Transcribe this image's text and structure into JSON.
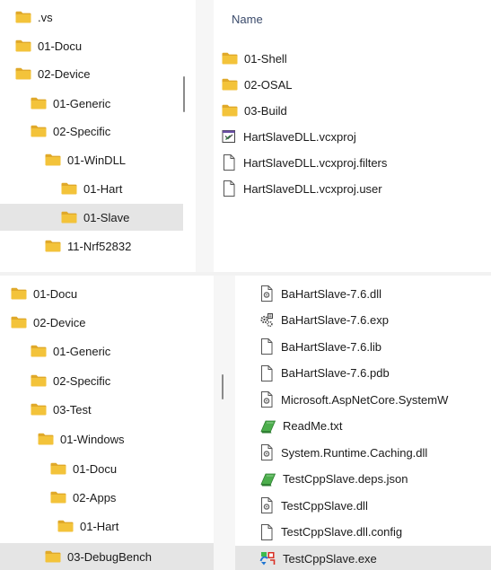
{
  "top_panel": {
    "column_header": "Name",
    "tree": [
      {
        "label": ".vs",
        "icon": "folder-icon",
        "selected": false
      },
      {
        "label": "01-Docu",
        "icon": "folder-icon",
        "selected": false
      },
      {
        "label": "02-Device",
        "icon": "folder-icon",
        "selected": false
      },
      {
        "label": "01-Generic",
        "icon": "folder-icon",
        "selected": false
      },
      {
        "label": "02-Specific",
        "icon": "folder-icon",
        "selected": false
      },
      {
        "label": "01-WinDLL",
        "icon": "folder-icon",
        "selected": false
      },
      {
        "label": "01-Hart",
        "icon": "folder-icon",
        "selected": false
      },
      {
        "label": "01-Slave",
        "icon": "folder-icon",
        "selected": true
      },
      {
        "label": "11-Nrf52832",
        "icon": "folder-icon",
        "selected": false
      }
    ],
    "files": [
      {
        "label": "01-Shell",
        "icon": "folder-icon"
      },
      {
        "label": "02-OSAL",
        "icon": "folder-icon"
      },
      {
        "label": "03-Build",
        "icon": "folder-icon"
      },
      {
        "label": "HartSlaveDLL.vcxproj",
        "icon": "vcxproj-icon"
      },
      {
        "label": "HartSlaveDLL.vcxproj.filters",
        "icon": "blank-file-icon"
      },
      {
        "label": "HartSlaveDLL.vcxproj.user",
        "icon": "blank-file-icon"
      }
    ]
  },
  "bottom_panel": {
    "tree": [
      {
        "label": "01-Docu",
        "icon": "folder-icon",
        "selected": false
      },
      {
        "label": "02-Device",
        "icon": "folder-icon",
        "selected": false
      },
      {
        "label": "01-Generic",
        "icon": "folder-icon",
        "selected": false
      },
      {
        "label": "02-Specific",
        "icon": "folder-icon",
        "selected": false
      },
      {
        "label": "03-Test",
        "icon": "folder-icon",
        "selected": false
      },
      {
        "label": "01-Windows",
        "icon": "folder-icon",
        "selected": false
      },
      {
        "label": "01-Docu",
        "icon": "folder-icon",
        "selected": false
      },
      {
        "label": "02-Apps",
        "icon": "folder-icon",
        "selected": false
      },
      {
        "label": "01-Hart",
        "icon": "folder-icon",
        "selected": false
      },
      {
        "label": "03-DebugBench",
        "icon": "folder-icon",
        "selected": true
      }
    ],
    "files": [
      {
        "label": "BaHartSlave-7.6.dll",
        "icon": "dll-icon",
        "selected": false
      },
      {
        "label": "BaHartSlave-7.6.exp",
        "icon": "exp-icon",
        "selected": false
      },
      {
        "label": "BaHartSlave-7.6.lib",
        "icon": "blank-file-icon",
        "selected": false
      },
      {
        "label": "BaHartSlave-7.6.pdb",
        "icon": "blank-file-icon",
        "selected": false
      },
      {
        "label": "Microsoft.AspNetCore.SystemW",
        "icon": "dll-icon",
        "selected": false
      },
      {
        "label": "ReadMe.txt",
        "icon": "text-file-icon",
        "selected": false
      },
      {
        "label": "System.Runtime.Caching.dll",
        "icon": "dll-icon",
        "selected": false
      },
      {
        "label": "TestCppSlave.deps.json",
        "icon": "text-file-icon",
        "selected": false
      },
      {
        "label": "TestCppSlave.dll",
        "icon": "dll-icon",
        "selected": false
      },
      {
        "label": "TestCppSlave.dll.config",
        "icon": "blank-file-icon",
        "selected": false
      },
      {
        "label": "TestCppSlave.exe",
        "icon": "exe-icon",
        "selected": true
      }
    ]
  },
  "colors": {
    "folder_body": "#f3c33a",
    "folder_tab": "#e0a92a",
    "selection": "#e5e5e5",
    "header_text": "#3a4a6b"
  }
}
